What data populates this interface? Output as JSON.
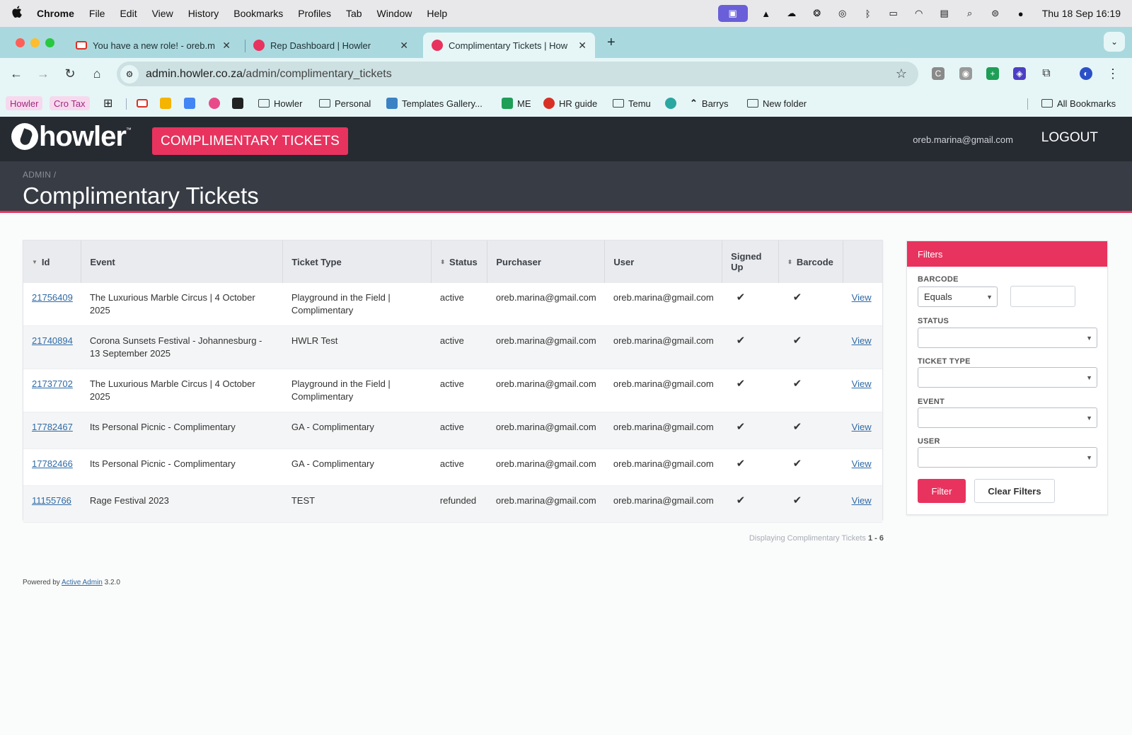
{
  "menubar": {
    "app": "Chrome",
    "items": [
      "File",
      "Edit",
      "View",
      "History",
      "Bookmarks",
      "Profiles",
      "Tab",
      "Window",
      "Help"
    ],
    "clock": "Thu 18 Sep  16:19"
  },
  "tabs": [
    {
      "title": "You have a new role! - oreb.m",
      "active": false
    },
    {
      "title": "Rep Dashboard | Howler",
      "active": false
    },
    {
      "title": "Complimentary Tickets | How",
      "active": true
    }
  ],
  "omnibox": {
    "host": "admin.howler.co.za",
    "path": "/admin/complimentary_tickets"
  },
  "bookmarks": {
    "pills": [
      "Howler",
      "Cro Tax"
    ],
    "items": [
      "Howler",
      "Personal",
      "Templates Gallery...",
      "ME",
      "HR guide",
      "Temu",
      "Barrys",
      "New folder"
    ],
    "all": "All Bookmarks"
  },
  "header": {
    "logo": "howler",
    "logo_tm": "™",
    "nav_tab": "COMPLIMENTARY TICKETS",
    "user_email": "oreb.marina@gmail.com",
    "logout": "LOGOUT"
  },
  "title_bar": {
    "breadcrumb": "ADMIN",
    "breadcrumb_sep": "/",
    "title": "Complimentary Tickets"
  },
  "table": {
    "columns": [
      "Id",
      "Event",
      "Ticket Type",
      "Status",
      "Purchaser",
      "User",
      "Signed Up",
      "Barcode",
      ""
    ],
    "rows": [
      {
        "id": "21756409",
        "event": "The Luxurious Marble Circus | 4 October 2025",
        "ticket_type": "Playground in the Field | Complimentary",
        "status": "active",
        "purchaser": "oreb.marina@gmail.com",
        "user": "oreb.marina@gmail.com",
        "signed_up": "✔",
        "barcode": "✔",
        "action": "View"
      },
      {
        "id": "21740894",
        "event": "Corona Sunsets Festival - Johannesburg - 13 September 2025",
        "ticket_type": "HWLR Test",
        "status": "active",
        "purchaser": "oreb.marina@gmail.com",
        "user": "oreb.marina@gmail.com",
        "signed_up": "✔",
        "barcode": "✔",
        "action": "View"
      },
      {
        "id": "21737702",
        "event": "The Luxurious Marble Circus | 4 October 2025",
        "ticket_type": "Playground in the Field | Complimentary",
        "status": "active",
        "purchaser": "oreb.marina@gmail.com",
        "user": "oreb.marina@gmail.com",
        "signed_up": "✔",
        "barcode": "✔",
        "action": "View"
      },
      {
        "id": "17782467",
        "event": "Its Personal Picnic - Complimentary",
        "ticket_type": "GA - Complimentary",
        "status": "active",
        "purchaser": "oreb.marina@gmail.com",
        "user": "oreb.marina@gmail.com",
        "signed_up": "✔",
        "barcode": "✔",
        "action": "View"
      },
      {
        "id": "17782466",
        "event": "Its Personal Picnic - Complimentary",
        "ticket_type": "GA - Complimentary",
        "status": "active",
        "purchaser": "oreb.marina@gmail.com",
        "user": "oreb.marina@gmail.com",
        "signed_up": "✔",
        "barcode": "✔",
        "action": "View"
      },
      {
        "id": "11155766",
        "event": "Rage Festival 2023",
        "ticket_type": "TEST",
        "status": "refunded",
        "purchaser": "oreb.marina@gmail.com",
        "user": "oreb.marina@gmail.com",
        "signed_up": "✔",
        "barcode": "✔",
        "action": "View"
      }
    ]
  },
  "pagination": {
    "label": "Displaying Complimentary Tickets",
    "range": "1 - 6"
  },
  "footer": {
    "prefix": "Powered by",
    "link": "Active Admin",
    "version": "3.2.0"
  },
  "filters": {
    "title": "Filters",
    "barcode_label": "BARCODE",
    "barcode_operator": "Equals",
    "status_label": "STATUS",
    "ticket_type_label": "TICKET TYPE",
    "event_label": "EVENT",
    "user_label": "USER",
    "filter_button": "Filter",
    "clear_button": "Clear Filters"
  },
  "colors": {
    "brand": "#e8335f",
    "header_bg": "#262a31",
    "title_bg": "#373c45",
    "link": "#2f6aa6"
  }
}
